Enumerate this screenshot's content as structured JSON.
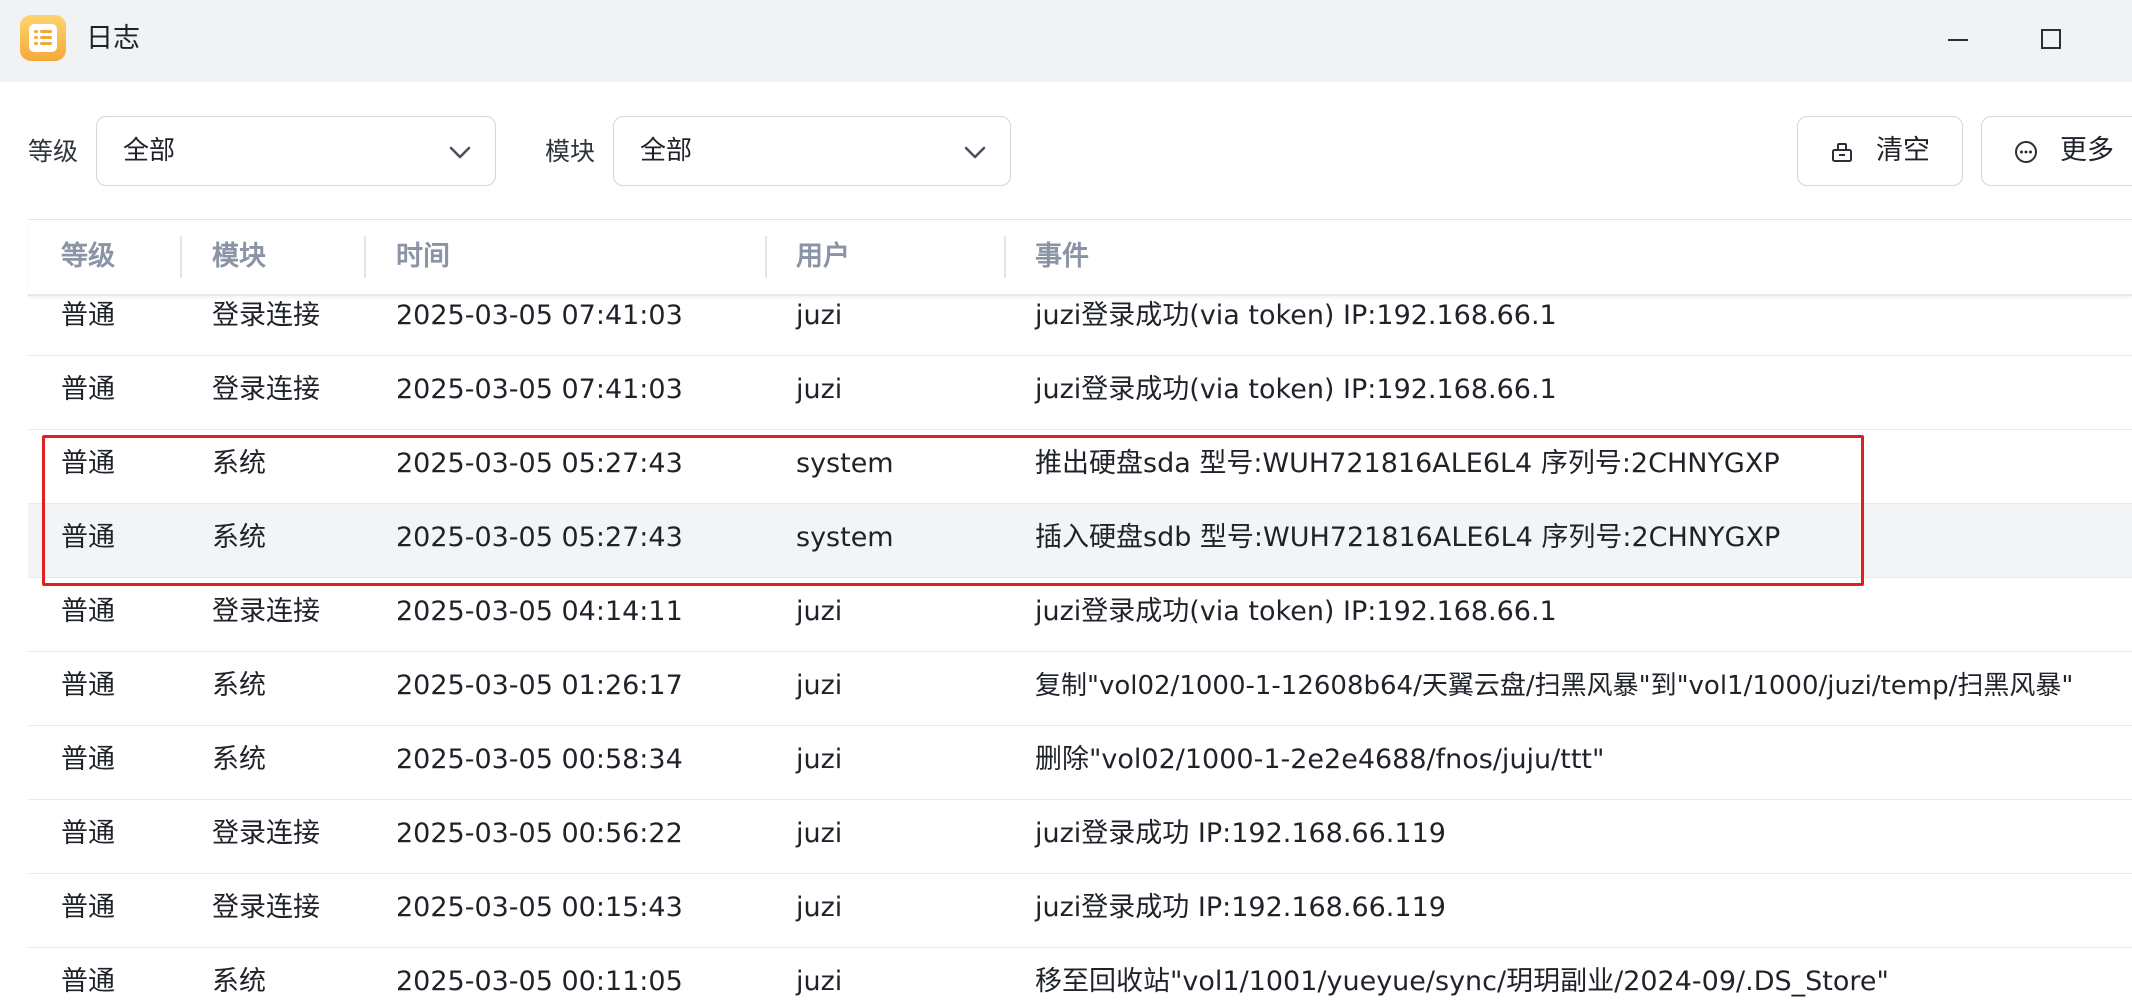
{
  "window": {
    "title": "日志",
    "icons": {
      "app": "log-app-icon",
      "minimize": "minimize-icon",
      "maximize": "maximize-icon"
    }
  },
  "filters": {
    "level": {
      "label": "等级",
      "value": "全部",
      "icon": "chevron-down-icon"
    },
    "module": {
      "label": "模块",
      "value": "全部",
      "icon": "chevron-down-icon"
    }
  },
  "toolbar": {
    "clear": {
      "label": "清空",
      "icon": "clear-icon"
    },
    "more": {
      "label": "更多",
      "icon": "more-icon"
    }
  },
  "table": {
    "columns": {
      "level": "等级",
      "module": "模块",
      "time": "时间",
      "user": "用户",
      "event": "事件"
    },
    "rows": [
      {
        "level": "普通",
        "module": "登录连接",
        "time": "2025-03-05 07:41:03",
        "user": "juzi",
        "event": "juzi登录成功(via token) IP:192.168.66.1"
      },
      {
        "level": "普通",
        "module": "登录连接",
        "time": "2025-03-05 07:41:03",
        "user": "juzi",
        "event": "juzi登录成功(via token) IP:192.168.66.1"
      },
      {
        "level": "普通",
        "module": "系统",
        "time": "2025-03-05 05:27:43",
        "user": "system",
        "event": "推出硬盘sda 型号:WUH721816ALE6L4 序列号:2CHNYGXP"
      },
      {
        "level": "普通",
        "module": "系统",
        "time": "2025-03-05 05:27:43",
        "user": "system",
        "event": "插入硬盘sdb 型号:WUH721816ALE6L4 序列号:2CHNYGXP"
      },
      {
        "level": "普通",
        "module": "登录连接",
        "time": "2025-03-05 04:14:11",
        "user": "juzi",
        "event": "juzi登录成功(via token) IP:192.168.66.1"
      },
      {
        "level": "普通",
        "module": "系统",
        "time": "2025-03-05 01:26:17",
        "user": "juzi",
        "event": "复制\"vol02/1000-1-12608b64/天翼云盘/扫黑风暴\"到\"vol1/1000/juzi/temp/扫黑风暴\""
      },
      {
        "level": "普通",
        "module": "系统",
        "time": "2025-03-05 00:58:34",
        "user": "juzi",
        "event": "删除\"vol02/1000-1-2e2e4688/fnos/juju/ttt\""
      },
      {
        "level": "普通",
        "module": "登录连接",
        "time": "2025-03-05 00:56:22",
        "user": "juzi",
        "event": "juzi登录成功 IP:192.168.66.119"
      },
      {
        "level": "普通",
        "module": "登录连接",
        "time": "2025-03-05 00:15:43",
        "user": "juzi",
        "event": "juzi登录成功 IP:192.168.66.119"
      },
      {
        "level": "普通",
        "module": "系统",
        "time": "2025-03-05 00:11:05",
        "user": "juzi",
        "event": "移至回收站\"vol1/1001/yueyue/sync/玥玥副业/2024-09/.DS_Store\""
      }
    ]
  },
  "colors": {
    "highlight": "#e02020",
    "header_text": "#8a94a6",
    "hover_row": "#f3f4f6"
  }
}
